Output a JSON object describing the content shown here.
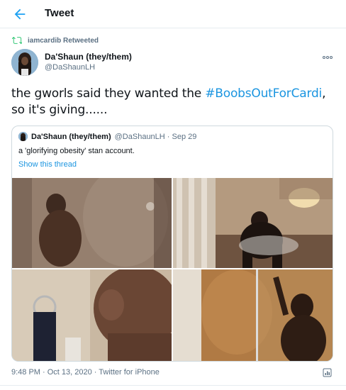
{
  "header": {
    "title": "Tweet",
    "back_icon": "arrow-left-icon",
    "accent": "#1da1f2"
  },
  "retweet": {
    "label": "iamcardib Retweeted",
    "icon": "retweet-icon"
  },
  "tweet": {
    "author_name": "Da'Shaun (they/them)",
    "author_handle": "@DaShaunLH",
    "more_icon": "more-horizontal-icon",
    "text_before": "the gworls said they wanted the ",
    "hashtag": "#BoobsOutForCardi",
    "text_after": ", so it's giving......",
    "hashtag_color": "#1b95e0"
  },
  "quote": {
    "author_name": "Da'Shaun (they/them)",
    "author_meta": "@DaShaunLH · Sep 29",
    "text": "a 'glorifying obesity' stan account.",
    "show_thread": "Show this thread",
    "media_count": 4
  },
  "footer": {
    "meta": "9:48 PM · Oct 13, 2020 · Twitter for iPhone",
    "stats_icon": "analytics-icon"
  }
}
